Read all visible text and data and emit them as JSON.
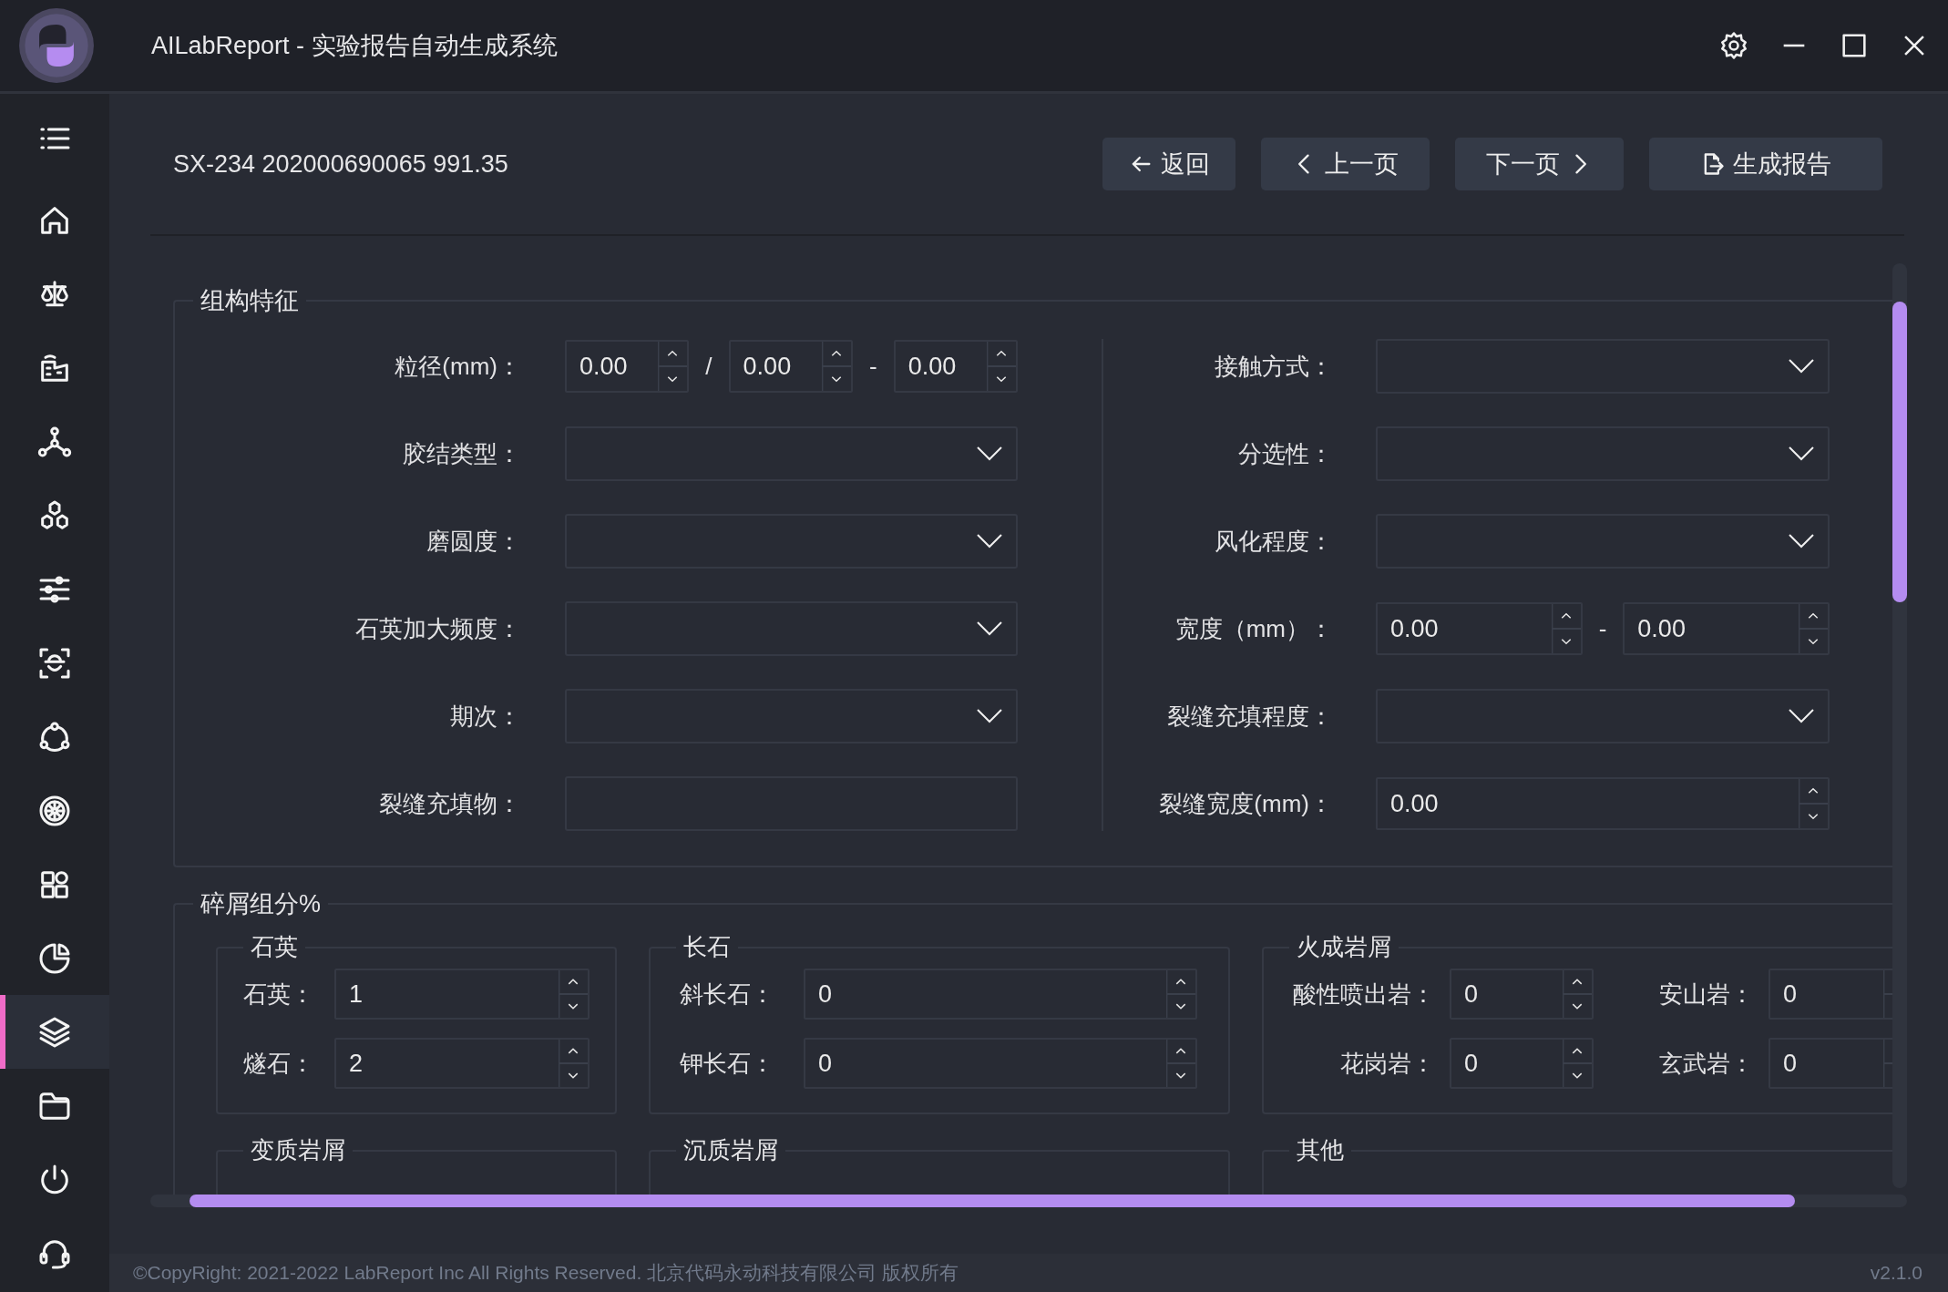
{
  "window": {
    "title": "AILabReport - 实验报告自动生成系统"
  },
  "sidebar": {
    "items": [
      {
        "kind": "home",
        "selected": false
      },
      {
        "kind": "scale",
        "selected": false
      },
      {
        "kind": "factory",
        "selected": false
      },
      {
        "kind": "network",
        "selected": false
      },
      {
        "kind": "hexagons",
        "selected": false
      },
      {
        "kind": "sliders",
        "selected": false
      },
      {
        "kind": "face-scan",
        "selected": false
      },
      {
        "kind": "cycle",
        "selected": false
      },
      {
        "kind": "wheel",
        "selected": false
      },
      {
        "kind": "grid",
        "selected": false
      },
      {
        "kind": "pie",
        "selected": false
      },
      {
        "kind": "layers",
        "selected": true
      },
      {
        "kind": "folder",
        "selected": false
      },
      {
        "kind": "power",
        "selected": false
      },
      {
        "kind": "headset",
        "selected": false
      }
    ]
  },
  "header": {
    "record": "SX-234 202000690065 991.35",
    "buttons": [
      {
        "kind": "back",
        "label": "返回"
      },
      {
        "kind": "prev",
        "label": "上一页"
      },
      {
        "kind": "next",
        "label": "下一页"
      },
      {
        "kind": "report",
        "label": "生成报告"
      }
    ]
  },
  "structure": {
    "title": "组构特征",
    "left": [
      {
        "kind": "range",
        "label": "粒径(mm)：",
        "values": [
          "0.00",
          "0.00",
          "0.00"
        ],
        "separators": [
          "/",
          "-"
        ]
      },
      {
        "kind": "select",
        "label": "胶结类型："
      },
      {
        "kind": "select",
        "label": "磨圆度："
      },
      {
        "kind": "select",
        "label": "石英加大频度："
      },
      {
        "kind": "select",
        "label": "期次："
      },
      {
        "kind": "text",
        "label": "裂缝充填物："
      }
    ],
    "right": [
      {
        "kind": "select",
        "label": "接触方式："
      },
      {
        "kind": "select",
        "label": "分选性："
      },
      {
        "kind": "select",
        "label": "风化程度："
      },
      {
        "kind": "range",
        "label": "宽度（mm）：",
        "values": [
          "0.00",
          "0.00"
        ],
        "separators": [
          "-"
        ]
      },
      {
        "kind": "select",
        "label": "裂缝充填程度："
      },
      {
        "kind": "spin",
        "label": "裂缝宽度(mm)：",
        "values": [
          "0.00"
        ]
      }
    ]
  },
  "debris": {
    "title": "碎屑组分%",
    "groups": [
      {
        "title": "石英",
        "fields": [
          {
            "label": "石英：",
            "value": "1"
          },
          {
            "label": "燧石：",
            "value": "2"
          }
        ]
      },
      {
        "title": "长石",
        "fields": [
          {
            "label": "斜长石：",
            "value": "0"
          },
          {
            "label": "钾长石：",
            "value": "0"
          }
        ]
      },
      {
        "title": "火成岩屑",
        "fields": [
          {
            "label": "酸性喷出岩：",
            "value": "0"
          },
          {
            "label": "安山岩：",
            "value": "0"
          },
          {
            "label": "花岗岩：",
            "value": "0"
          },
          {
            "label": "玄武岩：",
            "value": "0"
          }
        ]
      },
      {
        "title": "变质岩屑"
      },
      {
        "title": "沉质岩屑"
      },
      {
        "title": "其他"
      }
    ]
  },
  "footer": {
    "copyright": "©CopyRight: 2021-2022 LabReport Inc All Rights Reserved. 北京代码永动科技有限公司 版权所有",
    "version": "v2.1.0"
  }
}
